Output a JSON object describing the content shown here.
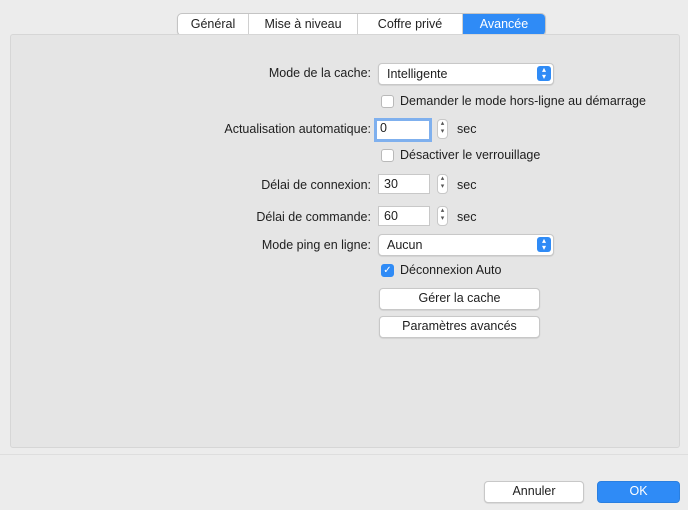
{
  "tabs": [
    {
      "label": "Général",
      "active": false
    },
    {
      "label": "Mise à niveau",
      "active": false
    },
    {
      "label": "Coffre privé",
      "active": false
    },
    {
      "label": "Avancée",
      "active": true
    }
  ],
  "settings": {
    "cache_mode": {
      "label": "Mode de la cache:",
      "value": "Intelligente"
    },
    "offline_prompt": {
      "label": "Demander le mode hors-ligne au démarrage",
      "checked": false
    },
    "auto_refresh": {
      "label": "Actualisation automatique:",
      "value": "0",
      "unit": "sec"
    },
    "disable_lock": {
      "label": "Désactiver le verrouillage",
      "checked": false
    },
    "connect_timeout": {
      "label": "Délai de connexion:",
      "value": "30",
      "unit": "sec"
    },
    "command_timeout": {
      "label": "Délai de commande:",
      "value": "60",
      "unit": "sec"
    },
    "ping_mode": {
      "label": "Mode ping en ligne:",
      "value": "Aucun"
    },
    "auto_disconnect": {
      "label": "Déconnexion Auto",
      "checked": true
    },
    "manage_cache_button": "Gérer la cache",
    "advanced_params_button": "Paramètres avancés"
  },
  "footer": {
    "cancel_label": "Annuler",
    "ok_label": "OK"
  },
  "colors": {
    "accent": "#2f8bf6",
    "window_bg": "#ececec",
    "pane_bg": "#e5e5e5"
  }
}
